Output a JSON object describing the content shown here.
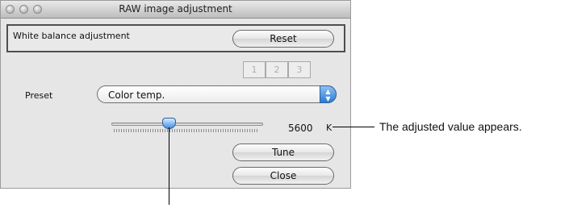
{
  "window": {
    "title": "RAW image adjustment"
  },
  "white_balance": {
    "label": "White balance adjustment",
    "reset_button": "Reset"
  },
  "presets": {
    "slots": [
      "1",
      "2",
      "3"
    ]
  },
  "preset_select": {
    "label": "Preset",
    "value": "Color temp."
  },
  "color_temp": {
    "value": "5600",
    "unit": "K",
    "slider_position": 0.38
  },
  "buttons": {
    "tune": "Tune",
    "close": "Close"
  },
  "annotation": {
    "text": "The adjusted value appears."
  }
}
